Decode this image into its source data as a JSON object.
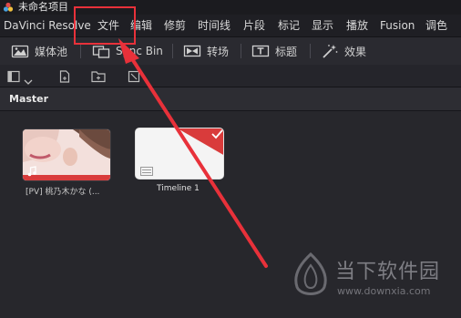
{
  "window": {
    "title": "未命名项目"
  },
  "menu": {
    "items": [
      "DaVinci Resolve",
      "文件",
      "编辑",
      "修剪",
      "时间线",
      "片段",
      "标记",
      "显示",
      "播放",
      "Fusion",
      "调色"
    ]
  },
  "toolbar": {
    "media_pool_label": "媒体池",
    "sync_bin_label": "Sync Bin",
    "transitions_label": "转场",
    "titles_label": "标题",
    "effects_label": "效果"
  },
  "panel": {
    "title": "Master"
  },
  "clips": [
    {
      "label": "[PV] 桃乃木かな (..."
    },
    {
      "label": "Timeline 1"
    }
  ],
  "watermark": {
    "brand": "当下软件园",
    "url": "www.downxia.com"
  },
  "colors": {
    "annotation": "#e8313a",
    "timeline_thumb": "#d93b3b",
    "background": "#28282e"
  }
}
